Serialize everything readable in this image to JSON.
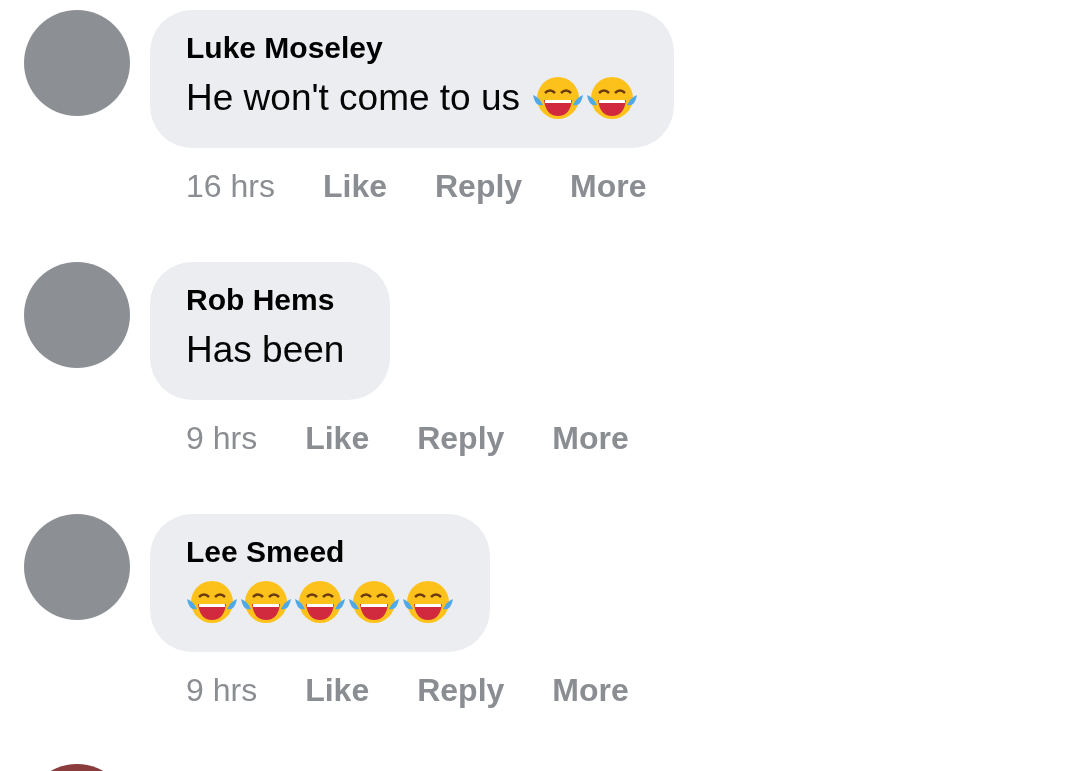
{
  "comments": [
    {
      "author": "Luke Moseley",
      "text": "He won't come to us",
      "emojis": [
        {
          "kind": "tears-of-joy"
        },
        {
          "kind": "tears-of-joy"
        }
      ],
      "time": "16 hrs",
      "actions": [
        "Like",
        "Reply",
        "More"
      ]
    },
    {
      "author": "Rob Hems",
      "text": "Has been",
      "time": "9 hrs",
      "actions": [
        "Like",
        "Reply",
        "More"
      ]
    },
    {
      "author": "Lee Smeed",
      "emojis": [
        {
          "kind": "tears-of-joy"
        },
        {
          "kind": "tears-of-joy"
        },
        {
          "kind": "tears-of-joy"
        },
        {
          "kind": "tears-of-joy"
        },
        {
          "kind": "tears-of-joy"
        }
      ],
      "time": "9 hrs",
      "actions": [
        "Like",
        "Reply",
        "More"
      ]
    }
  ]
}
